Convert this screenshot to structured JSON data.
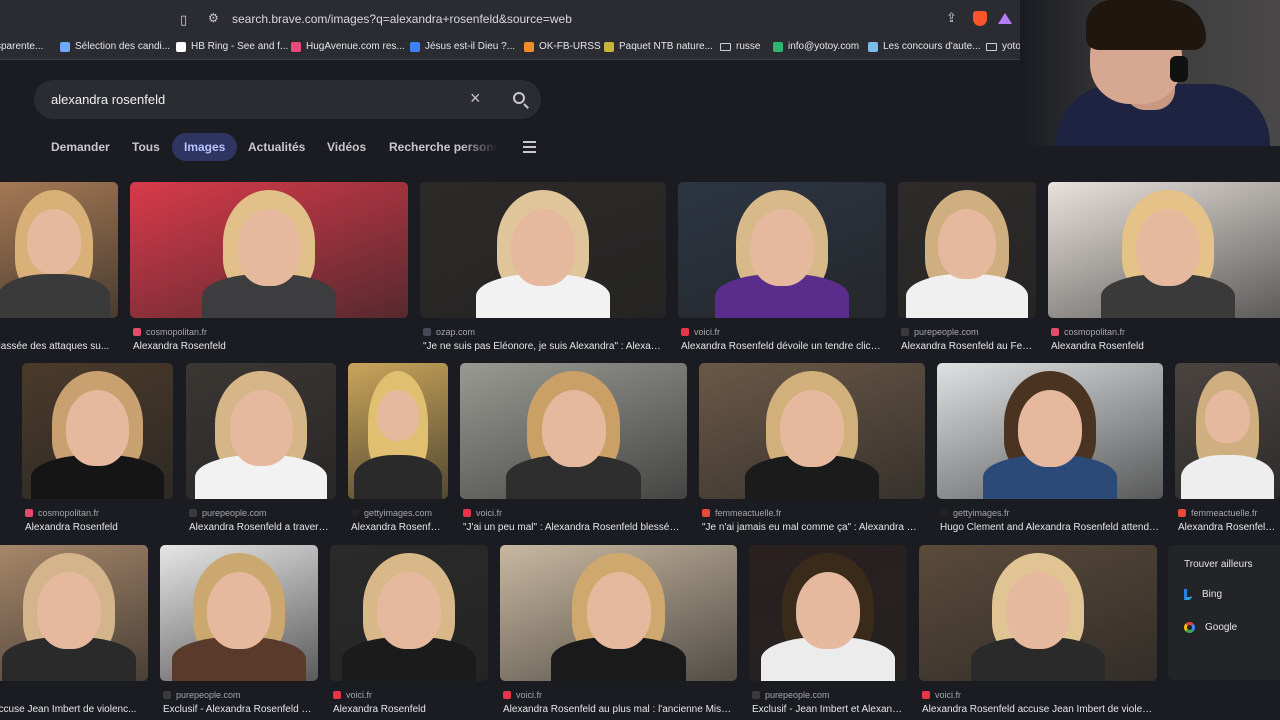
{
  "browser": {
    "url": "search.brave.com/images?q=alexandra+rosenfeld&source=web",
    "bookmarks": [
      {
        "label": "sparente...",
        "color": ""
      },
      {
        "label": "Sélection des candi...",
        "color": "#6fa8ff"
      },
      {
        "label": "HB Ring - See and f...",
        "color": "#ffffff"
      },
      {
        "label": "HugAvenue.com res...",
        "color": "#e8487a"
      },
      {
        "label": "Jésus est-il Dieu ?...",
        "color": "#3b82f6"
      },
      {
        "label": "OK-FB-URSS",
        "color": "#f08c2a"
      },
      {
        "label": "Paquet NTB nature...",
        "color": "#c9b43a"
      },
      {
        "label": "russe",
        "color": "folder"
      },
      {
        "label": "info@yotoy.com",
        "color": "#2bb673"
      },
      {
        "label": "Les concours d'aute...",
        "color": "#7bbde8"
      },
      {
        "label": "yoto",
        "color": "folder"
      }
    ]
  },
  "search": {
    "query": "alexandra rosenfeld",
    "clear_label": "×"
  },
  "tabs": [
    {
      "label": "Demander",
      "active": false
    },
    {
      "label": "Tous",
      "active": false
    },
    {
      "label": "Images",
      "active": true
    },
    {
      "label": "Actualités",
      "active": false
    },
    {
      "label": "Vidéos",
      "active": false
    },
    {
      "label": "Recherche personnalisée",
      "active": false
    }
  ],
  "results": [
    {
      "source": "",
      "title": ": lassée des attaques su...",
      "fav": "#e24b6b"
    },
    {
      "source": "cosmopolitan.fr",
      "title": "Alexandra Rosenfeld",
      "fav": "#e24b6b"
    },
    {
      "source": "ozap.com",
      "title": "\"Je ne suis pas Éléonore, je suis Alexandra\" : Alexandr...",
      "fav": "#444a55"
    },
    {
      "source": "voici.fr",
      "title": "Alexandra Rosenfeld dévoile un tendre cliché ...",
      "fav": "#e8334b"
    },
    {
      "source": "purepeople.com",
      "title": "Alexandra Rosenfeld au Festi...",
      "fav": "#3a3a3a"
    },
    {
      "source": "cosmopolitan.fr",
      "title": "Alexandra Rosenfeld",
      "fav": "#e24b6b"
    },
    {
      "source": "cosmopolitan.fr",
      "title": "Alexandra Rosenfeld",
      "fav": "#e24b6b"
    },
    {
      "source": "purepeople.com",
      "title": "Alexandra Rosenfeld a traversé ...",
      "fav": "#3a3a3a"
    },
    {
      "source": "gettyimages.com",
      "title": "Alexandra Rosenfeld...",
      "fav": "#222222"
    },
    {
      "source": "voici.fr",
      "title": "\"J'ai un peu mal\" : Alexandra Rosenfeld blessée, ...",
      "fav": "#e8334b"
    },
    {
      "source": "femmeactuelle.fr",
      "title": "\"Je n'ai jamais eu mal comme ça\" : Alexandra Ros...",
      "fav": "#e84a3a"
    },
    {
      "source": "gettyimages.fr",
      "title": "Hugo Clement and Alexandra Rosenfeld attend th...",
      "fav": "#222222"
    },
    {
      "source": "femmeactuelle.fr",
      "title": "Alexandra Rosenfeld a p",
      "fav": "#e84a3a"
    },
    {
      "source": "",
      "title": "accuse Jean Imbert de violenc...",
      "fav": "#e8334b"
    },
    {
      "source": "purepeople.com",
      "title": "Exclusif - Alexandra Rosenfeld et ...",
      "fav": "#3a3a3a"
    },
    {
      "source": "voici.fr",
      "title": "Alexandra Rosenfeld",
      "fav": "#e8334b"
    },
    {
      "source": "voici.fr",
      "title": "Alexandra Rosenfeld au plus mal : l'ancienne Miss Fr...",
      "fav": "#e8334b"
    },
    {
      "source": "purepeople.com",
      "title": "Exclusif - Jean Imbert et Alexandr...",
      "fav": "#3a3a3a"
    },
    {
      "source": "voici.fr",
      "title": "Alexandra Rosenfeld accuse Jean Imbert de violenc...",
      "fav": "#e8334b"
    }
  ],
  "elsewhere": {
    "heading": "Trouver ailleurs",
    "engines": [
      "Bing",
      "Google"
    ]
  }
}
